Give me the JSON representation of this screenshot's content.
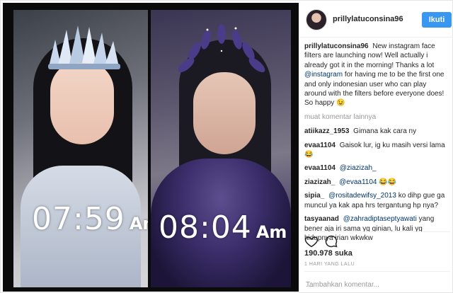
{
  "left": {
    "clock_left": {
      "time": "07:59",
      "ampm": "Am"
    },
    "clock_right": {
      "time": "08:04",
      "ampm": "Am"
    }
  },
  "header": {
    "username": "prillylatuconsina96",
    "follow_label": "Ikuti"
  },
  "caption": {
    "user": "prillylatuconsina96",
    "text_before": "New instagram face filters are launching now! Well actually i already got it in the morning! Thanks a lot",
    "mention": "@instagram",
    "text_after": "for having me to be the first one and only indonesian user who can play around with the filters before everyone does! So happy 😉"
  },
  "more_comments": "muat komentar lainnya",
  "comments": [
    {
      "user": "atiikazz_1953",
      "mention": "",
      "text": "Gimana kak cara ny"
    },
    {
      "user": "evaa1104",
      "mention": "",
      "text": "Gaisok lur, ig ku masih versi lama😂"
    },
    {
      "user": "evaa1104",
      "mention": "@ziazizah_",
      "text": ""
    },
    {
      "user": "ziazizah_",
      "mention": "@evaa1104",
      "text": "😂😂"
    },
    {
      "user": "sipia_",
      "mention": "@rositadewifsy_2013",
      "text": "ko dihp gue ga muncul ya kak apa hrs tergantung hp nya?"
    },
    {
      "user": "tasyaanad",
      "mention": "@zahradiptaseptyawati",
      "text": "yang bener aja iri sama yg ginian, lu kali yg hidupnya irian wkwkw"
    }
  ],
  "likes": "190.978 suka",
  "timestamp": "1 HARI YANG LALU",
  "add_comment_placeholder": "Tambahkan komentar...",
  "more_options": "...",
  "icons": [
    "heart-icon",
    "comment-icon"
  ]
}
